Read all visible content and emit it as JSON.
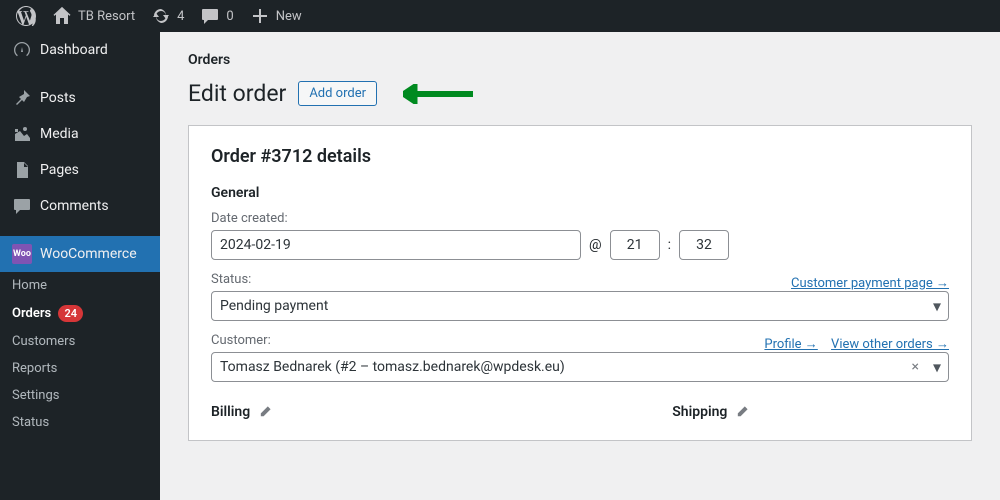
{
  "topbar": {
    "site_name": "TB Resort",
    "updates_count": "4",
    "comments_count": "0",
    "new_label": "New"
  },
  "sidebar": {
    "dashboard": "Dashboard",
    "posts": "Posts",
    "media": "Media",
    "pages": "Pages",
    "comments": "Comments",
    "woocommerce": "WooCommerce",
    "sub": {
      "home": "Home",
      "orders": "Orders",
      "orders_badge": "24",
      "customers": "Customers",
      "reports": "Reports",
      "settings": "Settings",
      "status": "Status"
    }
  },
  "breadcrumb": "Orders",
  "page": {
    "title": "Edit order",
    "add_order": "Add order"
  },
  "order": {
    "heading": "Order #3712 details",
    "general_label": "General",
    "date_label": "Date created:",
    "date_value": "2024-02-19",
    "at_symbol": "@",
    "hour": "21",
    "minute": "32",
    "status_label": "Status:",
    "status_value": "Pending payment",
    "customer_payment_link": "Customer payment page →",
    "customer_label": "Customer:",
    "profile_link": "Profile →",
    "view_orders_link": "View other orders →",
    "customer_value": "Tomasz Bednarek (#2 – tomasz.bednarek@wpdesk.eu)",
    "billing_label": "Billing",
    "shipping_label": "Shipping"
  }
}
